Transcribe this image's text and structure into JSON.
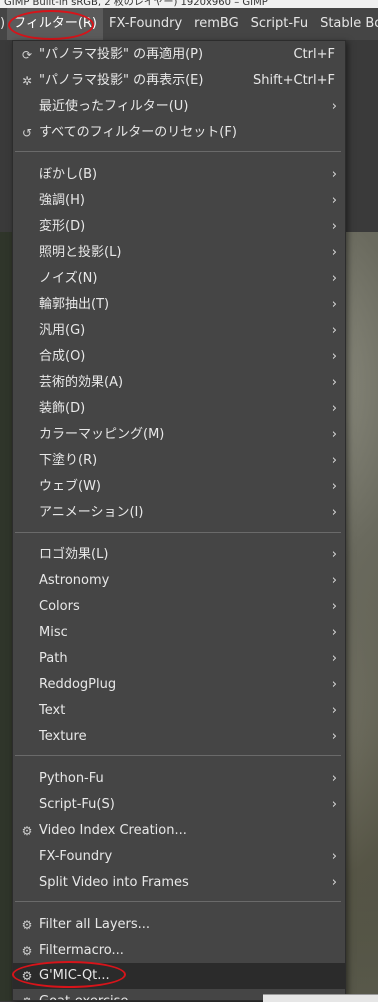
{
  "window_title": "GIMP Built-in sRGB, 2 枚のレイヤー) 1920x960 – GIMP",
  "menubar": {
    "lead": ")",
    "items": [
      {
        "label": "フィルター(R)"
      },
      {
        "label": "FX-Foundry"
      },
      {
        "label": "remBG"
      },
      {
        "label": "Script-Fu"
      },
      {
        "label": "Stable Boy"
      }
    ]
  },
  "menu": {
    "repeat_last": {
      "label": "\"パノラマ投影\" の再適用(P)",
      "accel": "Ctrl+F",
      "icon": "repeat-icon"
    },
    "reshow_last": {
      "label": "\"パノラマ投影\" の再表示(E)",
      "accel": "Shift+Ctrl+F",
      "icon": "reshow-icon"
    },
    "recent": {
      "label": "最近使ったフィルター(U)"
    },
    "reset_all": {
      "label": "すべてのフィルターのリセット(F)",
      "icon": "reset-icon"
    },
    "group1": [
      "ぼかし(B)",
      "強調(H)",
      "変形(D)",
      "照明と投影(L)",
      "ノイズ(N)",
      "輪郭抽出(T)",
      "汎用(G)",
      "合成(O)",
      "芸術的効果(A)",
      "装飾(D)",
      "カラーマッピング(M)",
      "下塗り(R)",
      "ウェブ(W)",
      "アニメーション(I)"
    ],
    "group2": [
      "ロゴ効果(L)",
      "Astronomy",
      "Colors",
      "Misc",
      "Path",
      "ReddogPlug",
      "Text",
      "Texture"
    ],
    "group3": {
      "python_fu": "Python-Fu",
      "script_fu": "Script-Fu(S)",
      "video_index": "Video Index Creation...",
      "fx_foundry": "FX-Foundry",
      "split_video": "Split Video into Frames"
    },
    "group4": {
      "filter_all_layers": "Filter all Layers...",
      "filtermacro": "Filtermacro...",
      "gmic": "G'MIC-Qt...",
      "goat": "Goat-exercise"
    },
    "submenu_arrow": "›"
  },
  "colors": {
    "menu_bg": "#454545",
    "highlight_bg": "#2b2b2b",
    "annotation": "#d7141a"
  }
}
